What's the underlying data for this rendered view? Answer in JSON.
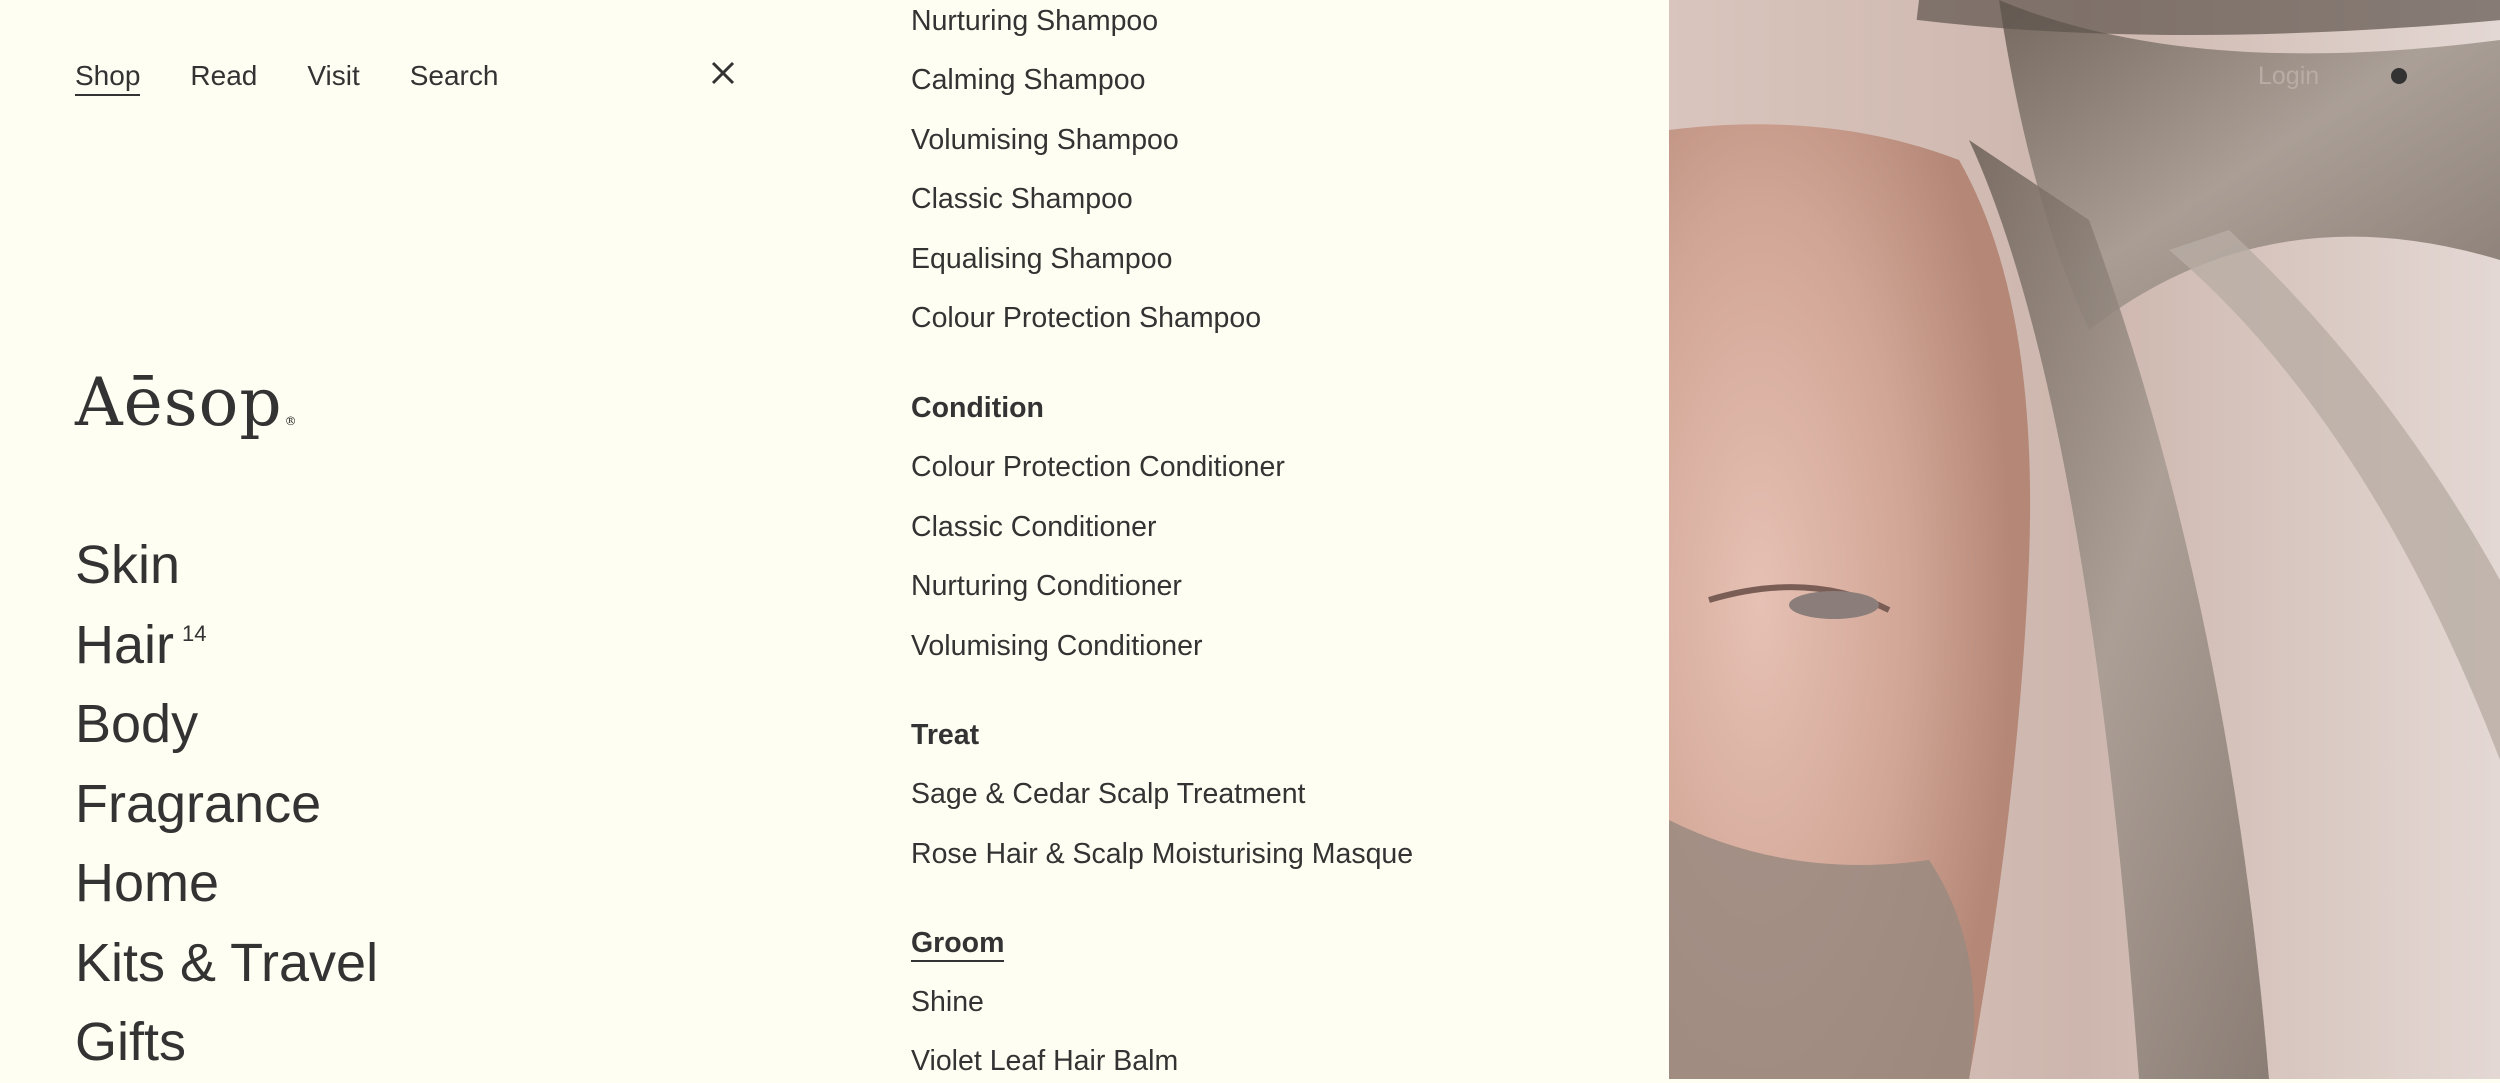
{
  "nav": {
    "tabs": [
      "Shop",
      "Read",
      "Visit",
      "Search"
    ],
    "active_tab": "Shop",
    "close_icon": "close-icon"
  },
  "logo": {
    "text": "Aēsop",
    "mark": "®"
  },
  "categories": [
    {
      "label": "Skin"
    },
    {
      "label": "Hair",
      "count": "14"
    },
    {
      "label": "Body"
    },
    {
      "label": "Fragrance"
    },
    {
      "label": "Home"
    },
    {
      "label": "Kits & Travel"
    },
    {
      "label": "Gifts"
    }
  ],
  "products": {
    "cleanse_items": [
      "Nurturing Shampoo",
      "Calming Shampoo",
      "Volumising Shampoo",
      "Classic Shampoo",
      "Equalising Shampoo",
      "Colour Protection Shampoo"
    ],
    "condition": {
      "heading": "Condition",
      "items": [
        "Colour Protection Conditioner",
        "Classic Conditioner",
        "Nurturing Conditioner",
        "Volumising Conditioner"
      ]
    },
    "treat": {
      "heading": "Treat",
      "items": [
        "Sage & Cedar Scalp Treatment",
        "Rose Hair & Scalp Moisturising Masque"
      ]
    },
    "groom": {
      "heading": "Groom",
      "items": [
        "Shine",
        "Violet Leaf Hair Balm"
      ]
    }
  },
  "header_right": {
    "login": "Login",
    "bag_icon": "bag-dot-icon"
  },
  "colors": {
    "background": "#fffef2",
    "text": "#333333"
  }
}
